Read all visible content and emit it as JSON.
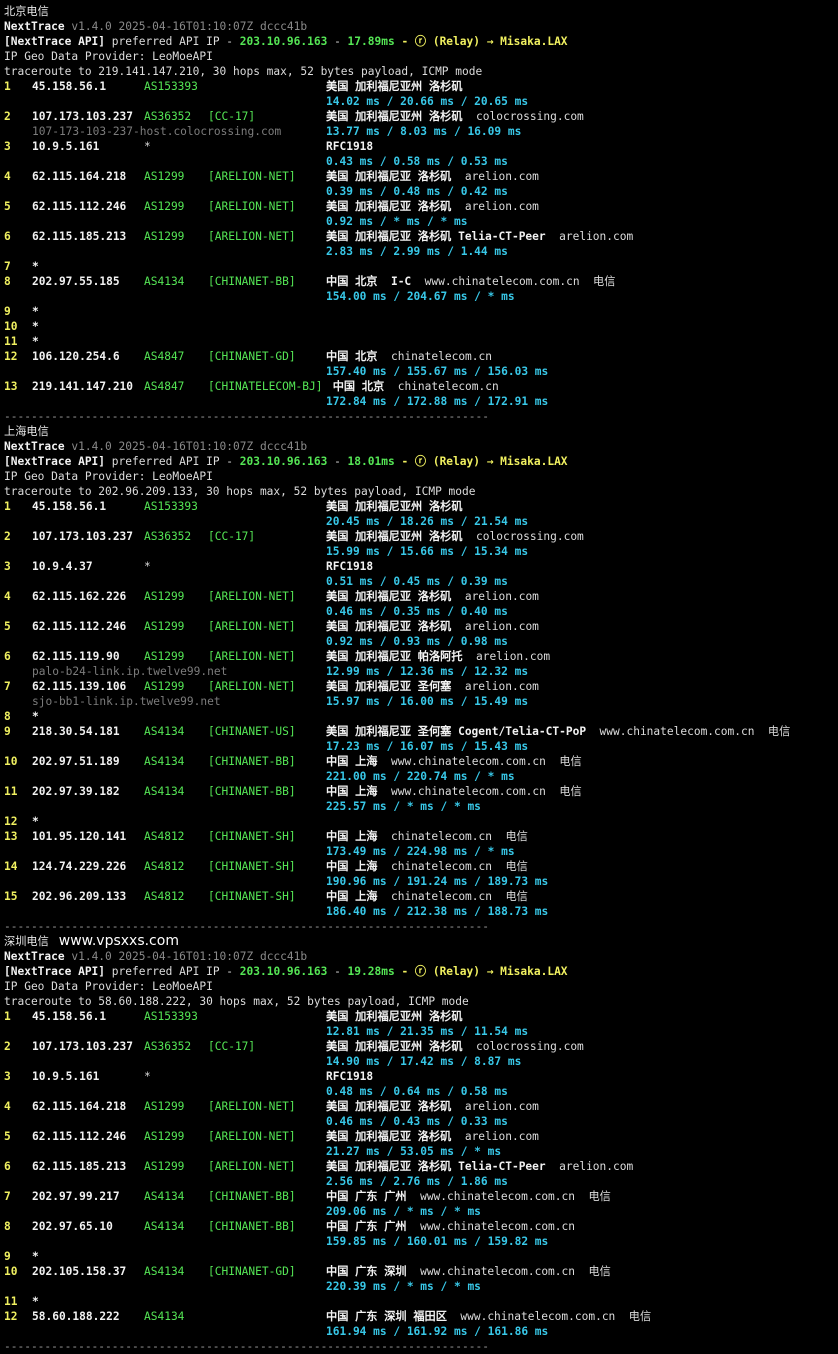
{
  "watermark": "www.vpsxxs.com",
  "blocks": [
    {
      "title": "北京电信",
      "header": {
        "app": "NextTrace",
        "version": "v1.4.0 2025-04-16T01:10:07Z dccc41b",
        "api_tag": "[NextTrace API]",
        "api_pref": " preferred API IP - ",
        "api_ip": "203.10.96.163",
        "api_dash": " - ",
        "api_ms": "17.89ms",
        "api_relay": " - ⓡ (Relay) → Misaka.LAX",
        "geo_provider": "IP Geo Data Provider: LeoMoeAPI",
        "trace": "traceroute to 219.141.147.210, 30 hops max, 52 bytes payload, ICMP mode"
      },
      "hops": [
        {
          "n": "1",
          "ip": "45.158.56.1",
          "asn": "AS153393",
          "tag": "",
          "geo": "美国 加利福尼亚州 洛杉矶",
          "dom": "",
          "rtt": "14.02 ms / 20.66 ms / 20.65 ms"
        },
        {
          "n": "2",
          "ip": "107.173.103.237",
          "asn": "AS36352",
          "tag": "[CC-17]",
          "geo": "美国 加利福尼亚州 洛杉矶",
          "dom": "colocrossing.com",
          "host": "107-173-103-237-host.colocrossing.com",
          "rtt": "13.77 ms / 8.03 ms / 16.09 ms"
        },
        {
          "n": "3",
          "ip": "10.9.5.161",
          "asn": "*",
          "tag": "",
          "geo": "RFC1918",
          "dom": "",
          "rtt": "0.43 ms / 0.58 ms / 0.53 ms"
        },
        {
          "n": "4",
          "ip": "62.115.164.218",
          "asn": "AS1299",
          "tag": "[ARELION-NET]",
          "geo": "美国 加利福尼亚 洛杉矶",
          "dom": "arelion.com",
          "rtt": "0.39 ms / 0.48 ms / 0.42 ms"
        },
        {
          "n": "5",
          "ip": "62.115.112.246",
          "asn": "AS1299",
          "tag": "[ARELION-NET]",
          "geo": "美国 加利福尼亚 洛杉矶",
          "dom": "arelion.com",
          "rtt": "0.92 ms / * ms / * ms"
        },
        {
          "n": "6",
          "ip": "62.115.185.213",
          "asn": "AS1299",
          "tag": "[ARELION-NET]",
          "geo": "美国 加利福尼亚 洛杉矶 Telia-CT-Peer",
          "dom": "arelion.com",
          "rtt": "2.83 ms / 2.99 ms / 1.44 ms"
        },
        {
          "n": "7",
          "star": true
        },
        {
          "n": "8",
          "ip": "202.97.55.185",
          "asn": "AS4134",
          "tag": "[CHINANET-BB]",
          "geo": "中国 北京  I-C",
          "dom": "www.chinatelecom.com.cn  电信",
          "rtt": "154.00 ms / 204.67 ms / * ms"
        },
        {
          "n": "9",
          "star": true
        },
        {
          "n": "10",
          "star": true
        },
        {
          "n": "11",
          "star": true
        },
        {
          "n": "12",
          "ip": "106.120.254.6",
          "asn": "AS4847",
          "tag": "[CHINANET-GD]",
          "geo": "中国 北京",
          "dom": "  chinatelecom.cn",
          "rtt": "157.40 ms / 155.67 ms / 156.03 ms"
        },
        {
          "n": "13",
          "ip": "219.141.147.210",
          "asn": "AS4847",
          "tag": "[CHINATELECOM-BJ]",
          "geo": " 中国 北京",
          "dom": "  chinatelecom.cn",
          "rtt": "172.84 ms / 172.88 ms / 172.91 ms"
        }
      ]
    },
    {
      "title": "上海电信",
      "header": {
        "app": "NextTrace",
        "version": "v1.4.0 2025-04-16T01:10:07Z dccc41b",
        "api_tag": "[NextTrace API]",
        "api_pref": " preferred API IP - ",
        "api_ip": "203.10.96.163",
        "api_dash": " - ",
        "api_ms": "18.01ms",
        "api_relay": " - ⓡ (Relay) → Misaka.LAX",
        "geo_provider": "IP Geo Data Provider: LeoMoeAPI",
        "trace": "traceroute to 202.96.209.133, 30 hops max, 52 bytes payload, ICMP mode"
      },
      "hops": [
        {
          "n": "1",
          "ip": "45.158.56.1",
          "asn": "AS153393",
          "tag": "",
          "geo": "美国 加利福尼亚州 洛杉矶",
          "dom": "",
          "rtt": "20.45 ms / 18.26 ms / 21.54 ms"
        },
        {
          "n": "2",
          "ip": "107.173.103.237",
          "asn": "AS36352",
          "tag": "[CC-17]",
          "geo": "美国 加利福尼亚州 洛杉矶",
          "dom": "colocrossing.com",
          "rtt": "15.99 ms / 15.66 ms / 15.34 ms"
        },
        {
          "n": "3",
          "ip": "10.9.4.37",
          "asn": "*",
          "tag": "",
          "geo": "RFC1918",
          "dom": "",
          "rtt": "0.51 ms / 0.45 ms / 0.39 ms"
        },
        {
          "n": "4",
          "ip": "62.115.162.226",
          "asn": "AS1299",
          "tag": "[ARELION-NET]",
          "geo": "美国 加利福尼亚 洛杉矶",
          "dom": "arelion.com",
          "rtt": "0.46 ms / 0.35 ms / 0.40 ms"
        },
        {
          "n": "5",
          "ip": "62.115.112.246",
          "asn": "AS1299",
          "tag": "[ARELION-NET]",
          "geo": "美国 加利福尼亚 洛杉矶",
          "dom": "arelion.com",
          "rtt": "0.92 ms / 0.93 ms / 0.98 ms"
        },
        {
          "n": "6",
          "ip": "62.115.119.90",
          "asn": "AS1299",
          "tag": "[ARELION-NET]",
          "geo": "美国 加利福尼亚 帕洛阿托",
          "dom": "arelion.com",
          "host": "palo-b24-link.ip.twelve99.net",
          "rtt": "12.99 ms / 12.36 ms / 12.32 ms"
        },
        {
          "n": "7",
          "ip": "62.115.139.106",
          "asn": "AS1299",
          "tag": "[ARELION-NET]",
          "geo": "美国 加利福尼亚 圣何塞",
          "dom": "arelion.com",
          "host": "sjo-bb1-link.ip.twelve99.net",
          "rtt": "15.97 ms / 16.00 ms / 15.49 ms"
        },
        {
          "n": "8",
          "star": true
        },
        {
          "n": "9",
          "ip": "218.30.54.181",
          "asn": "AS4134",
          "tag": "[CHINANET-US]",
          "geo": "美国 加利福尼亚 圣何塞 Cogent/Telia-CT-PoP",
          "dom": "www.chinatelecom.com.cn  电信",
          "rtt": "17.23 ms / 16.07 ms / 15.43 ms"
        },
        {
          "n": "10",
          "ip": "202.97.51.189",
          "asn": "AS4134",
          "tag": "[CHINANET-BB]",
          "geo": "中国 上海",
          "dom": "  www.chinatelecom.com.cn  电信",
          "rtt": "221.00 ms / 220.74 ms / * ms"
        },
        {
          "n": "11",
          "ip": "202.97.39.182",
          "asn": "AS4134",
          "tag": "[CHINANET-BB]",
          "geo": "中国 上海",
          "dom": "  www.chinatelecom.com.cn  电信",
          "rtt": "225.57 ms / * ms / * ms"
        },
        {
          "n": "12",
          "star": true
        },
        {
          "n": "13",
          "ip": "101.95.120.141",
          "asn": "AS4812",
          "tag": "[CHINANET-SH]",
          "geo": "中国 上海",
          "dom": "  chinatelecom.cn  电信",
          "rtt": "173.49 ms / 224.98 ms / * ms"
        },
        {
          "n": "14",
          "ip": "124.74.229.226",
          "asn": "AS4812",
          "tag": "[CHINANET-SH]",
          "geo": "中国 上海",
          "dom": "  chinatelecom.cn  电信",
          "rtt": "190.96 ms / 191.24 ms / 189.73 ms"
        },
        {
          "n": "15",
          "ip": "202.96.209.133",
          "asn": "AS4812",
          "tag": "[CHINANET-SH]",
          "geo": "中国 上海",
          "dom": "  chinatelecom.cn  电信",
          "rtt": "186.40 ms / 212.38 ms / 188.73 ms"
        }
      ]
    },
    {
      "title": "深圳电信",
      "header": {
        "app": "NextTrace",
        "version": "v1.4.0 2025-04-16T01:10:07Z dccc41b",
        "api_tag": "[NextTrace API]",
        "api_pref": " preferred API IP - ",
        "api_ip": "203.10.96.163",
        "api_dash": " - ",
        "api_ms": "19.28ms",
        "api_relay": " - ⓡ (Relay) → Misaka.LAX",
        "geo_provider": "IP Geo Data Provider: LeoMoeAPI",
        "trace": "traceroute to 58.60.188.222, 30 hops max, 52 bytes payload, ICMP mode"
      },
      "hops": [
        {
          "n": "1",
          "ip": "45.158.56.1",
          "asn": "AS153393",
          "tag": "",
          "geo": "美国 加利福尼亚州 洛杉矶",
          "dom": "",
          "rtt": "12.81 ms / 21.35 ms / 11.54 ms"
        },
        {
          "n": "2",
          "ip": "107.173.103.237",
          "asn": "AS36352",
          "tag": "[CC-17]",
          "geo": "美国 加利福尼亚州 洛杉矶",
          "dom": "colocrossing.com",
          "rtt": "14.90 ms / 17.42 ms / 8.87 ms"
        },
        {
          "n": "3",
          "ip": "10.9.5.161",
          "asn": "*",
          "tag": "",
          "geo": "RFC1918",
          "dom": "",
          "rtt": "0.48 ms / 0.64 ms / 0.58 ms"
        },
        {
          "n": "4",
          "ip": "62.115.164.218",
          "asn": "AS1299",
          "tag": "[ARELION-NET]",
          "geo": "美国 加利福尼亚 洛杉矶",
          "dom": "arelion.com",
          "rtt": "0.46 ms / 0.43 ms / 0.33 ms"
        },
        {
          "n": "5",
          "ip": "62.115.112.246",
          "asn": "AS1299",
          "tag": "[ARELION-NET]",
          "geo": "美国 加利福尼亚 洛杉矶",
          "dom": "arelion.com",
          "rtt": "21.27 ms / 53.05 ms / * ms"
        },
        {
          "n": "6",
          "ip": "62.115.185.213",
          "asn": "AS1299",
          "tag": "[ARELION-NET]",
          "geo": "美国 加利福尼亚 洛杉矶 Telia-CT-Peer",
          "dom": "arelion.com",
          "rtt": "2.56 ms / 2.76 ms / 1.86 ms"
        },
        {
          "n": "7",
          "ip": "202.97.99.217",
          "asn": "AS4134",
          "tag": "[CHINANET-BB]",
          "geo": "中国 广东 广州",
          "dom": "  www.chinatelecom.com.cn  电信",
          "rtt": "209.06 ms / * ms / * ms"
        },
        {
          "n": "8",
          "ip": "202.97.65.10",
          "asn": "AS4134",
          "tag": "[CHINANET-BB]",
          "geo": "中国 广东 广州",
          "dom": "  www.chinatelecom.com.cn",
          "rtt": "159.85 ms / 160.01 ms / 159.82 ms"
        },
        {
          "n": "9",
          "star": true
        },
        {
          "n": "10",
          "ip": "202.105.158.37",
          "asn": "AS4134",
          "tag": "[CHINANET-GD]",
          "geo": "中国 广东 深圳",
          "dom": "  www.chinatelecom.com.cn  电信",
          "rtt": "220.39 ms / * ms / * ms"
        },
        {
          "n": "11",
          "star": true
        },
        {
          "n": "12",
          "ip": "58.60.188.222",
          "asn": "AS4134",
          "tag": "",
          "geo": "中国 广东 深圳 福田区",
          "dom": "www.chinatelecom.com.cn  电信",
          "rtt": "161.94 ms / 161.92 ms / 161.86 ms"
        }
      ]
    }
  ],
  "separator": "------------------------------------------------------------------------"
}
